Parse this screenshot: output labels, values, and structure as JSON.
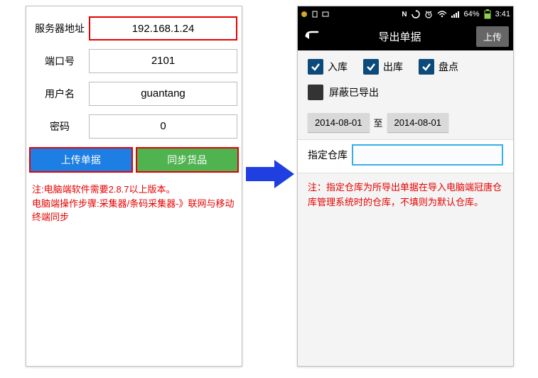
{
  "left": {
    "labels": {
      "server": "服务器地址",
      "port": "端口号",
      "user": "用户名",
      "pass": "密码"
    },
    "values": {
      "server": "192.168.1.24",
      "port": "2101",
      "user": "guantang",
      "pass": "0"
    },
    "buttons": {
      "upload": "上传单据",
      "sync": "同步货品"
    },
    "note": "注:电脑端软件需要2.8.7以上版本。\n电脑端操作步骤:采集器/条码采集器-》联网与移动终端同步"
  },
  "right": {
    "statusbar": {
      "battery_text": "64%",
      "time": "3:41"
    },
    "titlebar": {
      "title": "导出单据",
      "upload": "上传"
    },
    "checks": {
      "in": "入库",
      "out": "出库",
      "stock": "盘点"
    },
    "shield": "屏蔽已导出",
    "dates": {
      "from": "2014-08-01",
      "to_label": "至",
      "to": "2014-08-01"
    },
    "warehouse": {
      "label": "指定仓库",
      "value": ""
    },
    "note": "注：指定仓库为所导出单据在导入电脑端冠唐仓库管理系统时的仓库，不填则为默认仓库。"
  }
}
